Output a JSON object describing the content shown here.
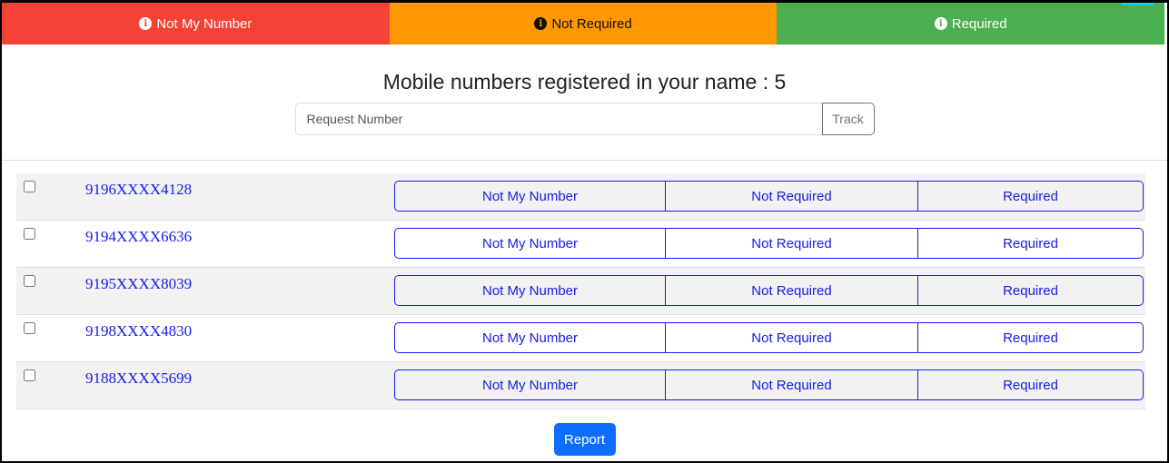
{
  "topbar": {
    "items": [
      {
        "label": "Not My Number",
        "color": "#f44336",
        "icon": "info-icon"
      },
      {
        "label": "Not Required",
        "color": "#ff9800",
        "icon": "info-icon"
      },
      {
        "label": "Required",
        "color": "#4caf50",
        "icon": "info-icon"
      }
    ]
  },
  "header": {
    "title": "Mobile numbers registered in your name : 5",
    "search_placeholder": "Request Number",
    "search_value": "",
    "track_label": "Track"
  },
  "rows": [
    {
      "number": "9196XXXX4128",
      "checked": false,
      "actions": [
        "Not My Number",
        "Not Required",
        "Required"
      ]
    },
    {
      "number": "9194XXXX6636",
      "checked": false,
      "actions": [
        "Not My Number",
        "Not Required",
        "Required"
      ]
    },
    {
      "number": "9195XXXX8039",
      "checked": false,
      "actions": [
        "Not My Number",
        "Not Required",
        "Required"
      ]
    },
    {
      "number": "9198XXXX4830",
      "checked": false,
      "actions": [
        "Not My Number",
        "Not Required",
        "Required"
      ]
    },
    {
      "number": "9188XXXX5699",
      "checked": false,
      "actions": [
        "Not My Number",
        "Not Required",
        "Required"
      ]
    }
  ],
  "footer": {
    "report_label": "Report"
  },
  "colors": {
    "accent_link": "#1a1ae6",
    "primary_button": "#0d6efd"
  }
}
